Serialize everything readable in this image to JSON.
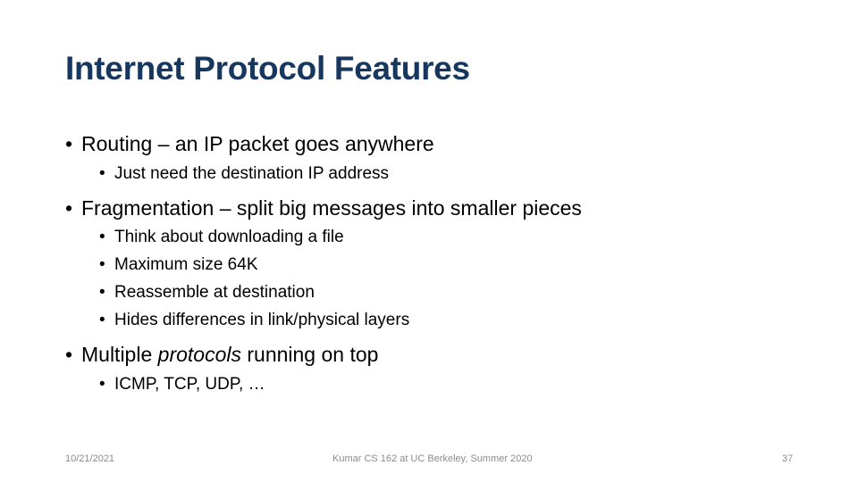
{
  "slide": {
    "title": "Internet Protocol Features",
    "bullet_glyph": "•",
    "bullets": [
      {
        "text": "Routing – an IP packet goes anywhere",
        "sub": [
          "Just need the destination IP address"
        ]
      },
      {
        "text": "Fragmentation – split big messages into smaller pieces",
        "sub": [
          "Think about downloading a file",
          "Maximum size 64K",
          "Reassemble at destination",
          "Hides differences in link/physical layers"
        ]
      },
      {
        "text_before": "Multiple ",
        "text_italic": "protocols",
        "text_after": " running on top",
        "sub": [
          "ICMP, TCP, UDP, …"
        ]
      }
    ]
  },
  "footer": {
    "date": "10/21/2021",
    "center": "Kumar CS 162 at UC Berkeley, Summer 2020",
    "page_number": "37"
  },
  "colors": {
    "title": "#17375e",
    "footer": "#8c8c8c"
  }
}
